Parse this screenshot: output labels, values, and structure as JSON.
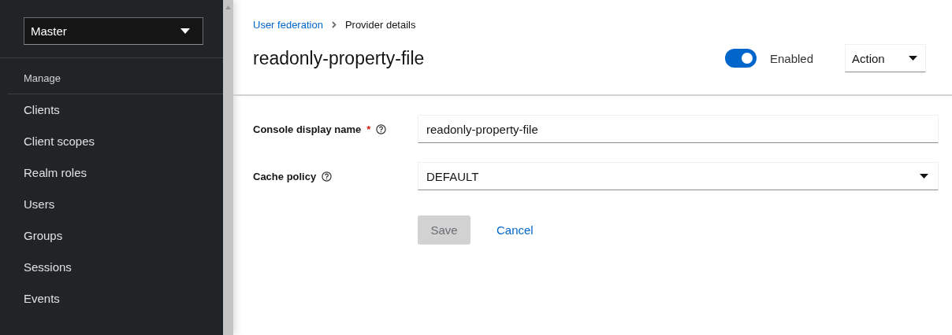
{
  "sidebar": {
    "realm_select": {
      "value": "Master"
    },
    "section": "Manage",
    "items": [
      {
        "label": "Clients",
        "selected": false
      },
      {
        "label": "Client scopes",
        "selected": false
      },
      {
        "label": "Realm roles",
        "selected": false
      },
      {
        "label": "Users",
        "selected": false
      },
      {
        "label": "Groups",
        "selected": false
      },
      {
        "label": "Sessions",
        "selected": false
      },
      {
        "label": "Events",
        "selected": false
      }
    ]
  },
  "breadcrumb": [
    {
      "label": "User federation",
      "kind": "link"
    },
    {
      "label": "Provider details",
      "kind": "current"
    }
  ],
  "header": {
    "title": "readonly-property-file",
    "enabled_toggle": {
      "label": "Enabled",
      "on": true
    },
    "action_menu": {
      "label": "Action"
    }
  },
  "form": {
    "fields": [
      {
        "label": "Console display name",
        "required": true,
        "required_mark": "*",
        "kind": "text",
        "value": "readonly-property-file"
      },
      {
        "label": "Cache policy",
        "required": false,
        "kind": "select",
        "value": "DEFAULT"
      }
    ],
    "save": {
      "label": "Save",
      "disabled": true
    },
    "cancel": {
      "label": "Cancel"
    }
  }
}
